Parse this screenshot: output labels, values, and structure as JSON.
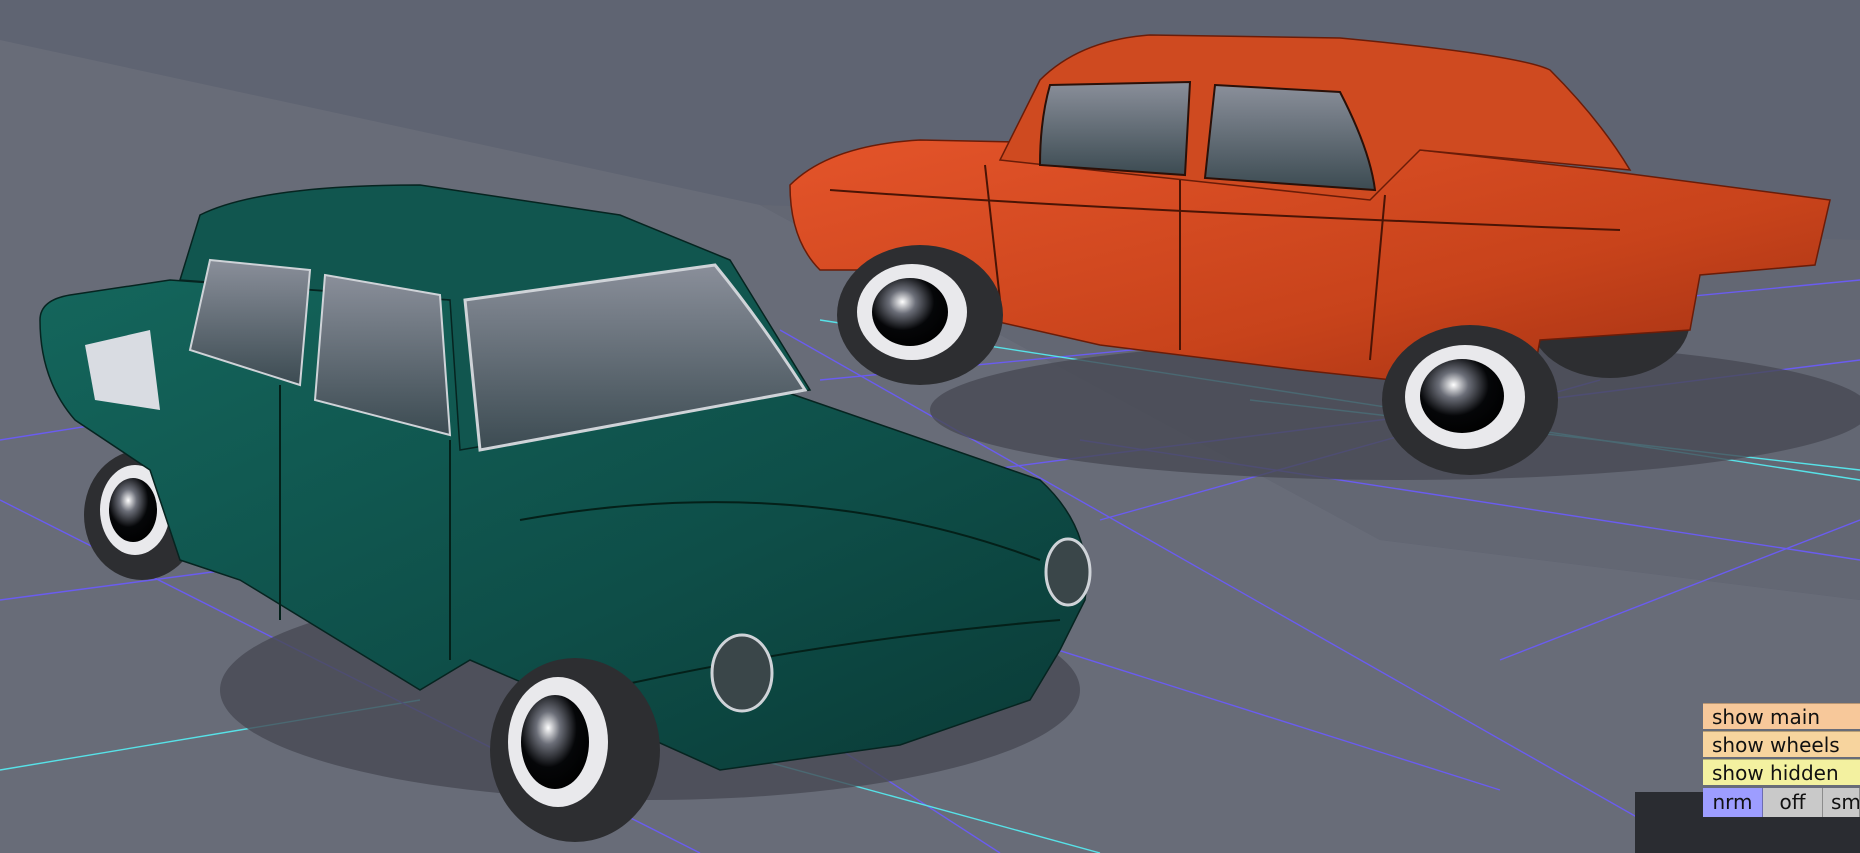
{
  "colors": {
    "background": "#5f6472",
    "floor": "#6b6f7a",
    "floor_shadow": "#4a4e58",
    "grid_blue": "#6a5cf0",
    "grid_cyan": "#57e2e8",
    "green_car": "#0e4e48",
    "red_car": "#c8431b",
    "tire": "#2d2e31",
    "rim": "#e9e9ec"
  },
  "scene": {
    "cars": [
      {
        "name": "green-sedan",
        "color": "#0e4e48"
      },
      {
        "name": "orange-sedan",
        "color": "#c8431b"
      }
    ]
  },
  "panel": {
    "buttons": [
      {
        "label": "show main",
        "color": "#f7c89a"
      },
      {
        "label": "show wheels",
        "color": "#f7d49e"
      },
      {
        "label": "show hidden",
        "color": "#f3f1a0"
      }
    ],
    "modes": [
      {
        "label": "nrm",
        "color": "#9d9dff",
        "active": true
      },
      {
        "label": "off",
        "color": "#c9c9c9",
        "active": false
      },
      {
        "label": "sm",
        "color": "#c9c9c9",
        "active": false
      }
    ]
  }
}
